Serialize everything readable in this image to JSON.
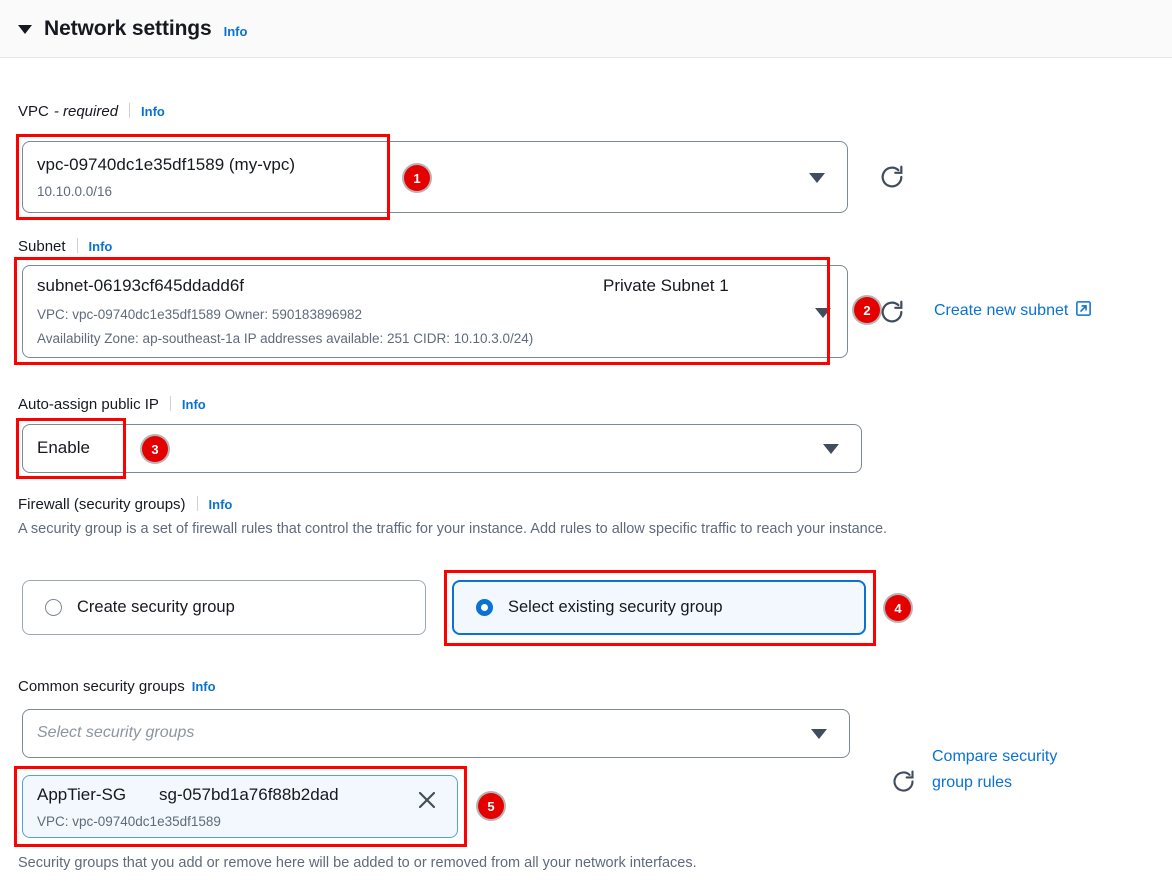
{
  "section": {
    "title": "Network settings",
    "info_label": "Info",
    "caret_icon": "caret-down-icon"
  },
  "vpc": {
    "label": "VPC",
    "required_suffix": "- required",
    "info_label": "Info",
    "value_primary": "vpc-09740dc1e35df1589 (my-vpc)",
    "value_secondary": "10.10.0.0/16",
    "refresh_icon": "refresh-icon"
  },
  "subnet": {
    "label": "Subnet",
    "info_label": "Info",
    "value_primary": "subnet-06193cf645ddadd6f",
    "value_name": "Private Subnet 1",
    "meta_line1": "VPC: vpc-09740dc1e35df1589     Owner: 590183896982",
    "meta_line2": "Availability Zone: ap-southeast-1a     IP addresses available: 251     CIDR: 10.10.3.0/24)",
    "refresh_icon": "refresh-icon",
    "create_link": "Create new subnet",
    "external_icon": "external-link-icon"
  },
  "auto_assign_ip": {
    "label": "Auto-assign public IP",
    "info_label": "Info",
    "value": "Enable"
  },
  "firewall": {
    "label": "Firewall (security groups)",
    "info_label": "Info",
    "description": "A security group is a set of firewall rules that control the traffic for your instance. Add rules to allow specific traffic to reach your instance.",
    "options": [
      {
        "label": "Create security group",
        "selected": false
      },
      {
        "label": "Select existing security group",
        "selected": true
      }
    ]
  },
  "common_security_groups": {
    "label": "Common security groups",
    "info_label": "Info",
    "placeholder": "Select security groups",
    "refresh_icon": "refresh-icon",
    "compare_link_line1": "Compare security",
    "compare_link_line2": "group rules",
    "selected_token": {
      "name": "AppTier-SG",
      "id": "sg-057bd1a76f88b2dad",
      "vpc": "VPC: vpc-09740dc1e35df1589",
      "remove_icon": "close-icon"
    },
    "hint": "Security groups that you add or remove here will be added to or removed from all your network interfaces."
  },
  "annotations": {
    "accent_color": "#ff0000",
    "badges": [
      {
        "number": "1"
      },
      {
        "number": "2"
      },
      {
        "number": "3"
      },
      {
        "number": "4"
      },
      {
        "number": "5"
      }
    ]
  }
}
